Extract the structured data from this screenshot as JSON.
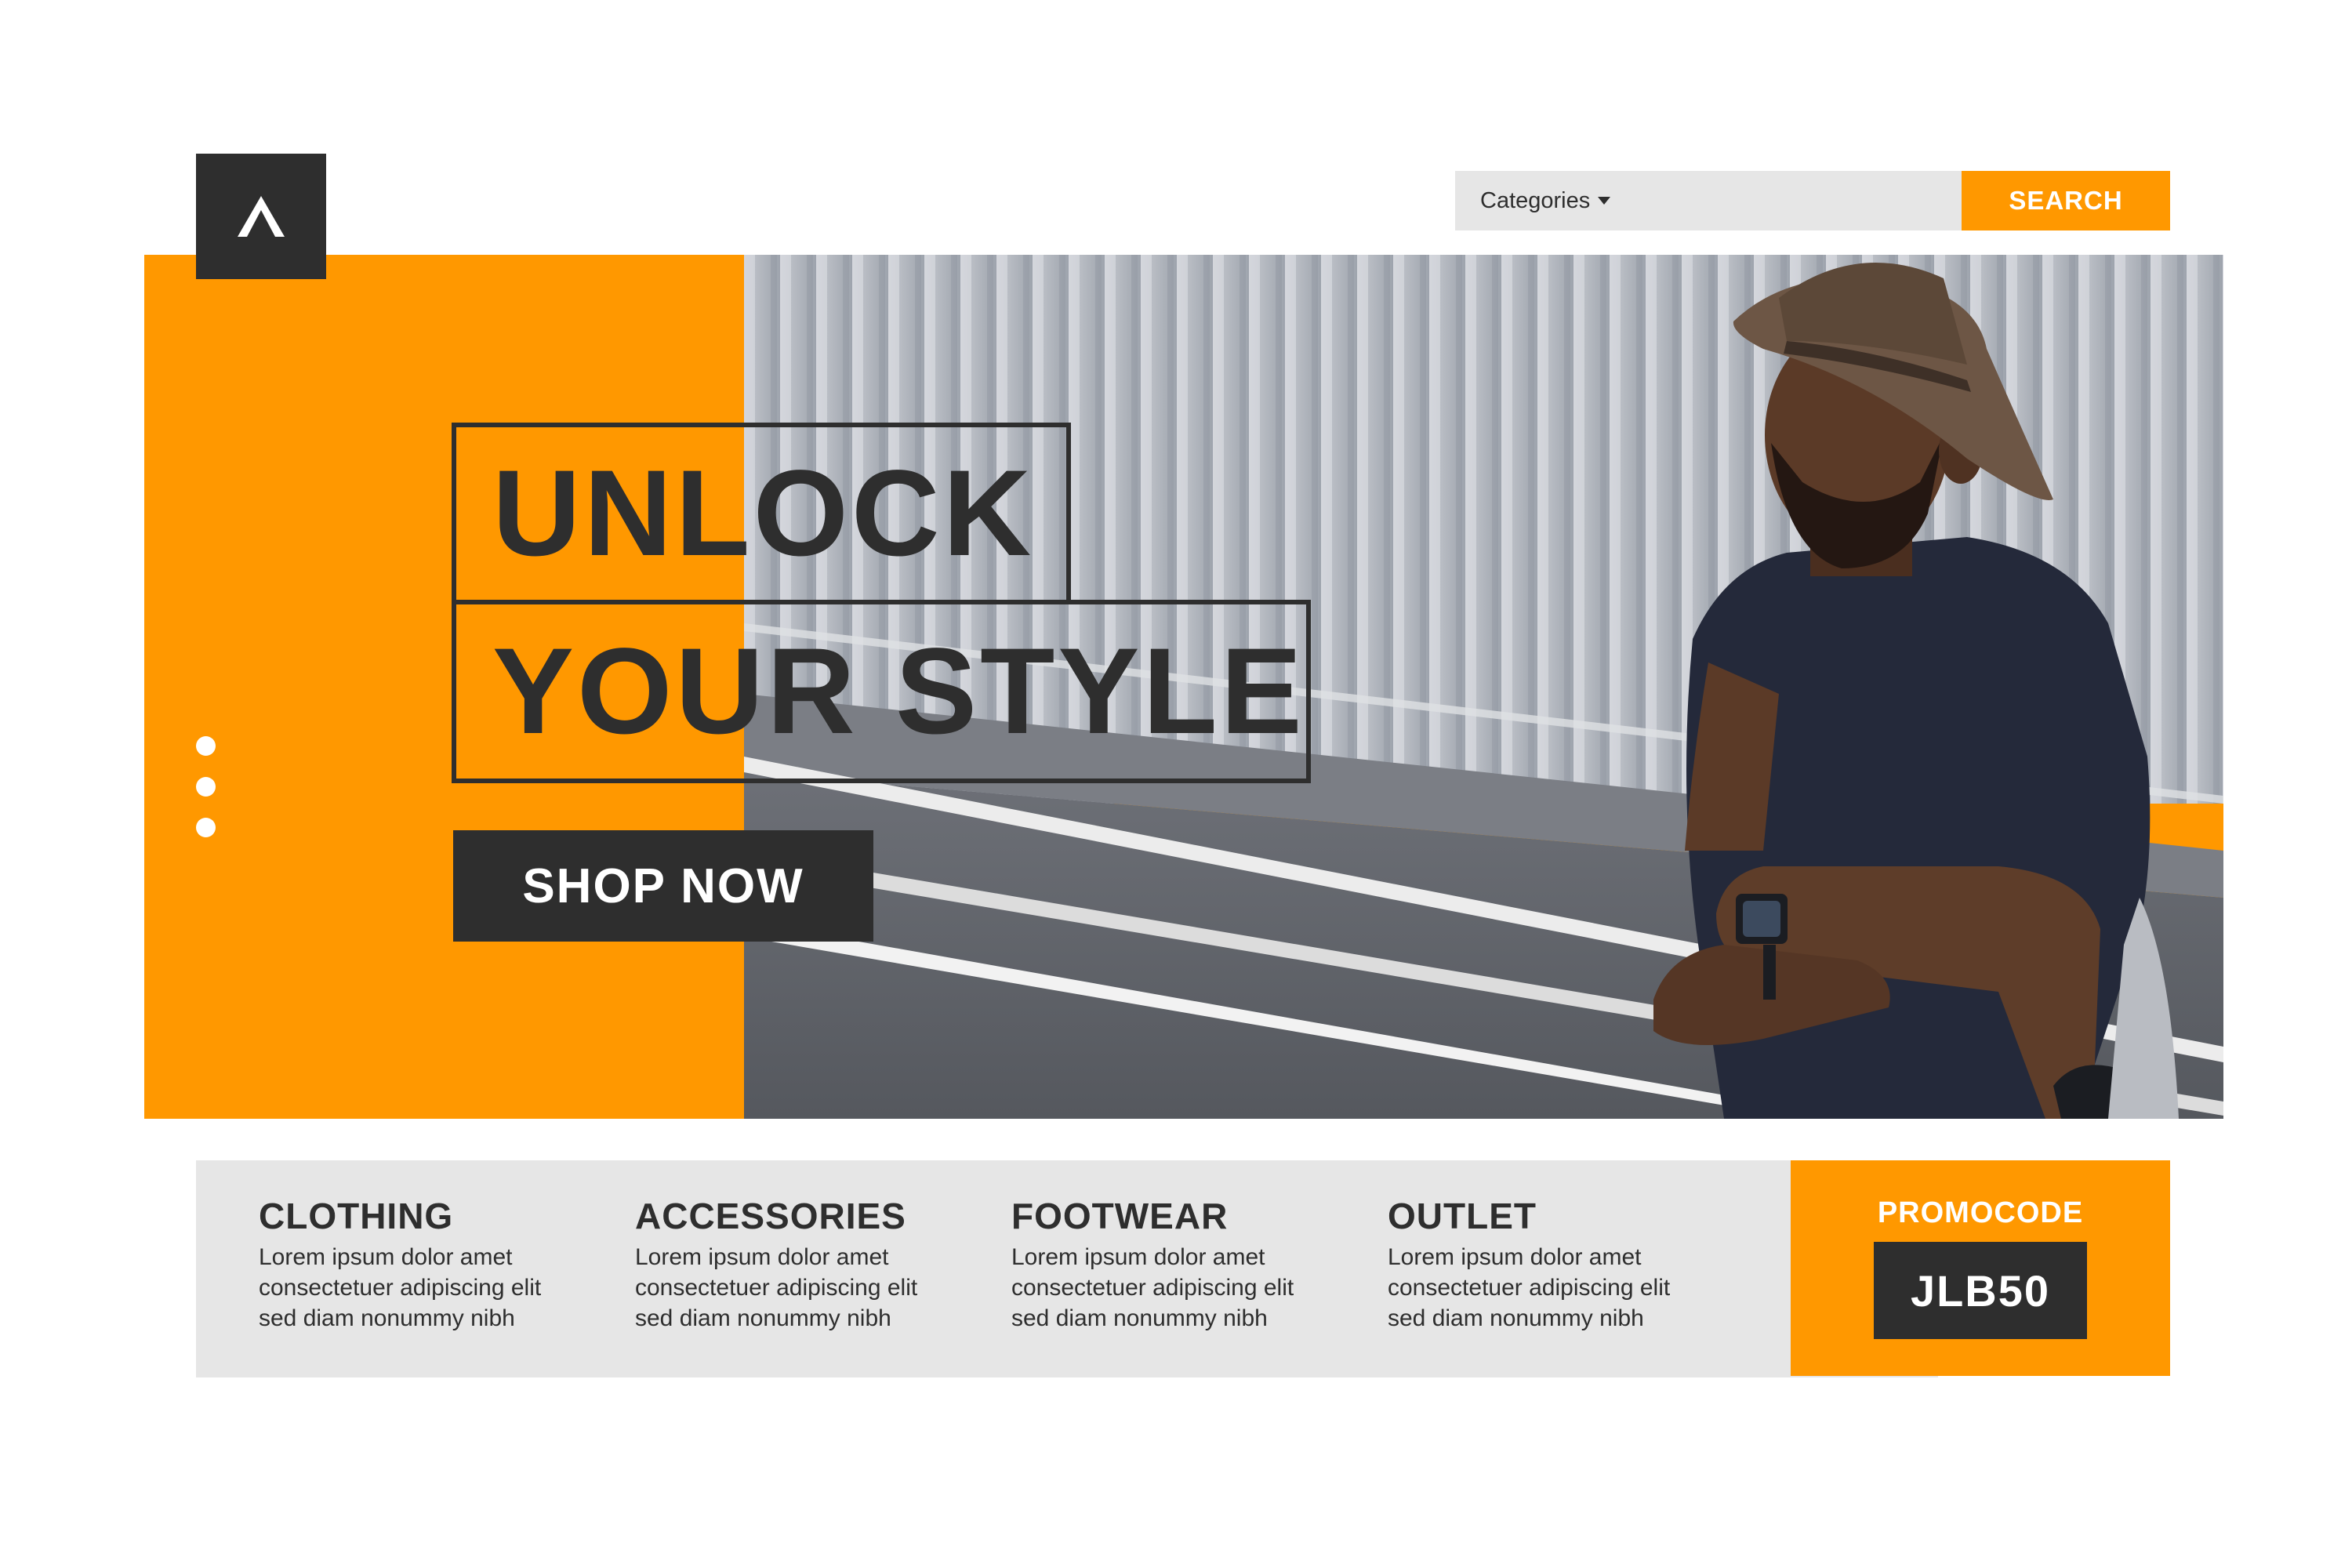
{
  "brand": {
    "logo_icon": "a-logo-icon"
  },
  "search": {
    "categories_label": "Categories",
    "button_label": "SEARCH"
  },
  "hero": {
    "headline_line1": "UNLOCK",
    "headline_line2": "YOUR STYLE",
    "cta_label": "SHOP NOW",
    "slide_count": 3
  },
  "categories": [
    {
      "title": "CLOTHING",
      "desc": [
        "Lorem ipsum dolor amet",
        "consectetuer adipiscing elit",
        "sed diam nonummy nibh"
      ]
    },
    {
      "title": "ACCESSORIES",
      "desc": [
        "Lorem ipsum dolor amet",
        "consectetuer adipiscing elit",
        "sed diam nonummy nibh"
      ]
    },
    {
      "title": "FOOTWEAR",
      "desc": [
        "Lorem ipsum dolor amet",
        "consectetuer adipiscing elit",
        "sed diam nonummy nibh"
      ]
    },
    {
      "title": "OUTLET",
      "desc": [
        "Lorem ipsum dolor amet",
        "consectetuer adipiscing elit",
        "sed diam nonummy nibh"
      ]
    }
  ],
  "promo": {
    "label": "PROMOCODE",
    "code": "JLB50"
  },
  "colors": {
    "accent": "#ff9800",
    "dark": "#2e2e2e",
    "panel": "#e6e6e6",
    "white": "#ffffff"
  }
}
